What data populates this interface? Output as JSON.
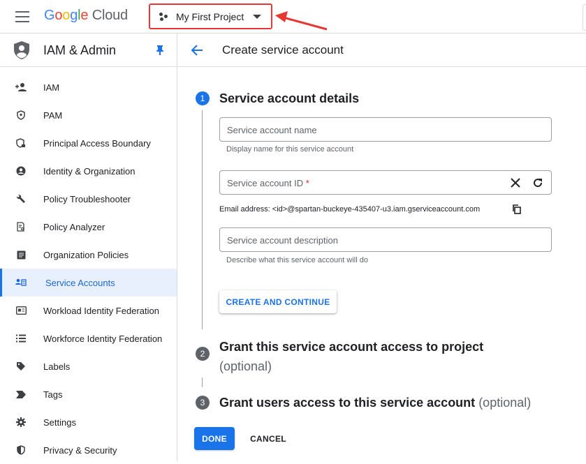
{
  "header": {
    "logo": {
      "g1": "G",
      "g2": "o",
      "g3": "o",
      "g4": "g",
      "g5": "l",
      "g6": "e",
      "cloud": " Cloud"
    },
    "project_name": "My First Project"
  },
  "sidebar": {
    "title": "IAM & Admin",
    "items": [
      {
        "label": "IAM",
        "icon": "person-add-icon"
      },
      {
        "label": "PAM",
        "icon": "shield-icon"
      },
      {
        "label": "Principal Access Boundary",
        "icon": "shield-lock-icon"
      },
      {
        "label": "Identity & Organization",
        "icon": "account-circle-icon"
      },
      {
        "label": "Policy Troubleshooter",
        "icon": "wrench-icon"
      },
      {
        "label": "Policy Analyzer",
        "icon": "document-search-icon"
      },
      {
        "label": "Organization Policies",
        "icon": "list-box-icon"
      },
      {
        "label": "Service Accounts",
        "icon": "service-account-icon",
        "active": true
      },
      {
        "label": "Workload Identity Federation",
        "icon": "id-card-icon"
      },
      {
        "label": "Workforce Identity Federation",
        "icon": "list-icon"
      },
      {
        "label": "Labels",
        "icon": "tag-icon"
      },
      {
        "label": "Tags",
        "icon": "label-arrow-icon"
      },
      {
        "label": "Settings",
        "icon": "gear-icon"
      },
      {
        "label": "Privacy & Security",
        "icon": "shield-half-icon"
      }
    ]
  },
  "main": {
    "title": "Create service account",
    "steps": [
      {
        "number": "1",
        "title": "Service account details",
        "optional": ""
      },
      {
        "number": "2",
        "title": "Grant this service account access to project",
        "optional": "(optional)"
      },
      {
        "number": "3",
        "title": "Grant users access to this service account",
        "optional": "(optional)"
      }
    ],
    "form": {
      "name_placeholder": "Service account name",
      "name_hint": "Display name for this service account",
      "id_placeholder": "Service account ID",
      "id_required": "*",
      "email": "Email address: <id>@spartan-buckeye-435407-u3.iam.gserviceaccount.com",
      "description_placeholder": "Service account description",
      "description_hint": "Describe what this service account will do",
      "create_button": "CREATE AND CONTINUE"
    },
    "done_button": "DONE",
    "cancel_button": "CANCEL"
  },
  "colors": {
    "accent": "#1a73e8",
    "annotation": "#e53935"
  }
}
